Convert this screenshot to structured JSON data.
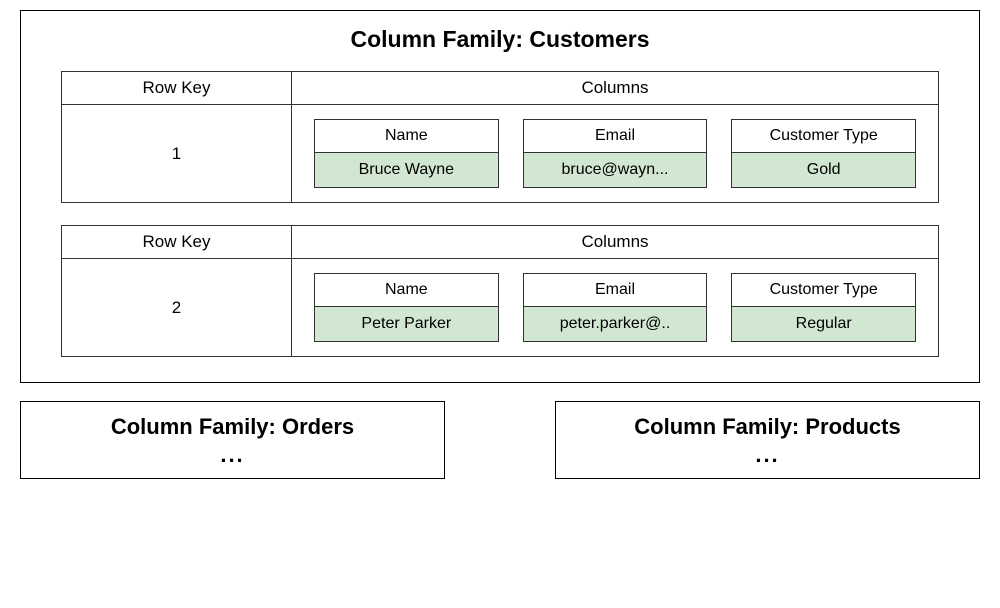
{
  "main_cf": {
    "title": "Column Family: Customers",
    "rowkey_header": "Row Key",
    "columns_header": "Columns",
    "rows": [
      {
        "key": "1",
        "columns": [
          {
            "name": "Name",
            "value": "Bruce Wayne"
          },
          {
            "name": "Email",
            "value": "bruce@wayn..."
          },
          {
            "name": "Customer Type",
            "value": "Gold"
          }
        ]
      },
      {
        "key": "2",
        "columns": [
          {
            "name": "Name",
            "value": "Peter Parker"
          },
          {
            "name": "Email",
            "value": "peter.parker@.."
          },
          {
            "name": "Customer Type",
            "value": "Regular"
          }
        ]
      }
    ]
  },
  "mini_cfs": [
    {
      "title": "Column Family: Orders",
      "ellipsis": "..."
    },
    {
      "title": "Column Family: Products",
      "ellipsis": "..."
    }
  ]
}
